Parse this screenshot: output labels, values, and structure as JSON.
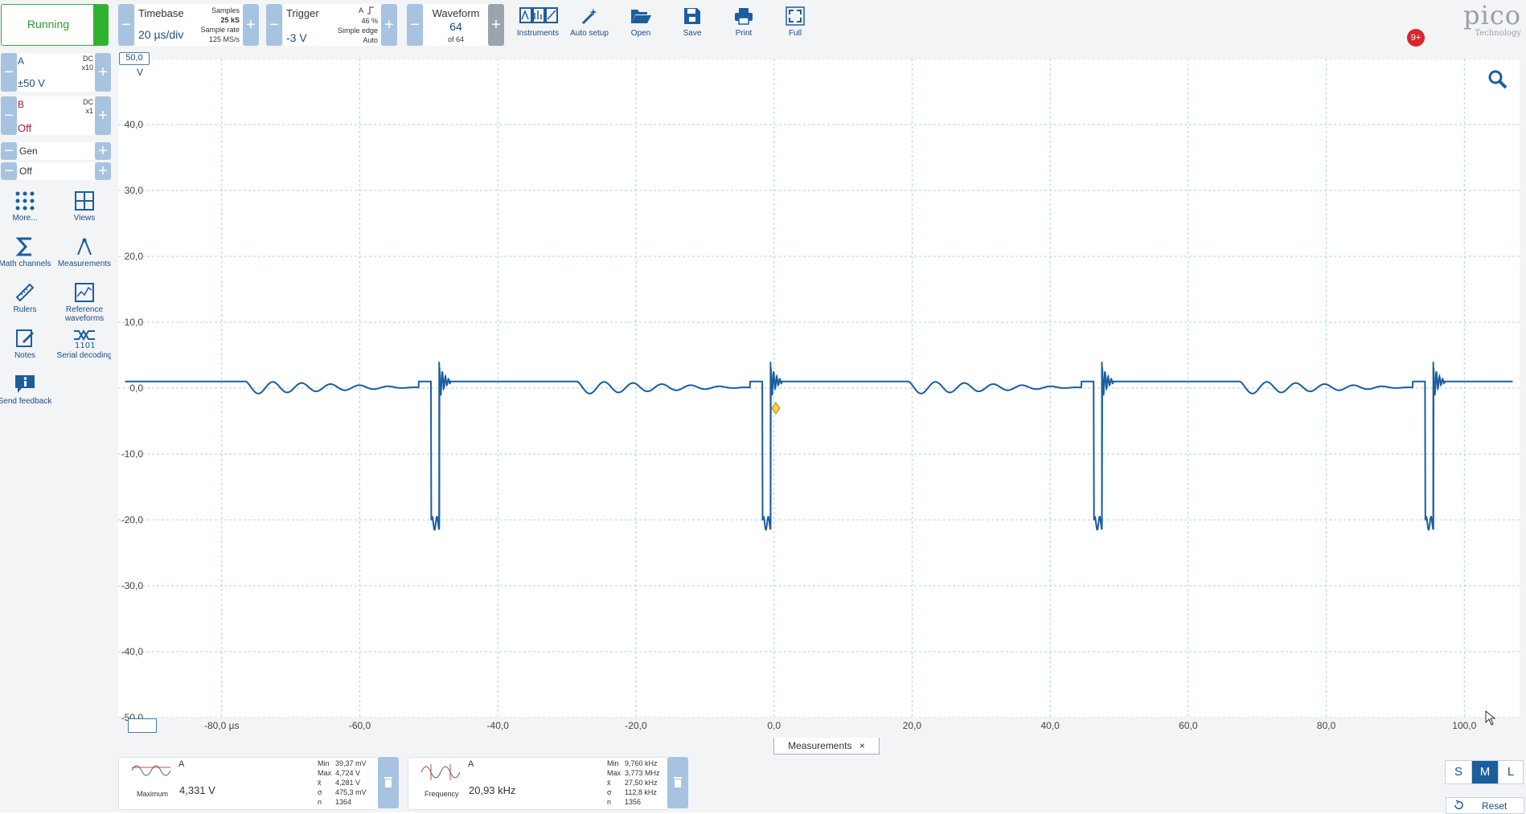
{
  "status": {
    "run_label": "Running"
  },
  "timebase": {
    "label": "Timebase",
    "value": "20 µs/div",
    "samples_label": "Samples",
    "samples_value": "25 kS",
    "rate_label": "Sample rate",
    "rate_value": "125 MS/s"
  },
  "trigger": {
    "label": "Trigger",
    "value": "-3 V",
    "channel": "A",
    "percent": "46 %",
    "type": "Simple edge",
    "mode": "Auto"
  },
  "waveform": {
    "label": "Waveform",
    "current": "64",
    "of": "of 64"
  },
  "toolbar": {
    "instruments": "Instruments",
    "auto_setup": "Auto setup",
    "open": "Open",
    "save": "Save",
    "print": "Print",
    "full": "Full"
  },
  "brand": {
    "logo": "pico",
    "logo_sub": "Technology",
    "notification_count": "9+"
  },
  "channels": [
    {
      "name": "A",
      "coupling": "DC",
      "probe": "x10",
      "range": "±50 V"
    },
    {
      "name": "B",
      "coupling": "DC",
      "probe": "x1",
      "range": "Off"
    }
  ],
  "generator": {
    "label": "Gen",
    "value": "Off"
  },
  "side_tools": {
    "more": "More...",
    "views": "Views",
    "math": "Math channels",
    "measurements": "Measurements",
    "rulers": "Rulers",
    "reference": "Reference waveforms",
    "notes": "Notes",
    "serial": "Serial decoding",
    "feedback": "Send feedback"
  },
  "plot": {
    "y_unit": "V",
    "y_ticks": [
      "50,0",
      "40,0",
      "30,0",
      "20,0",
      "10,0",
      "0,0",
      "-10,0",
      "-20,0",
      "-30,0",
      "-40,0",
      "-50,0"
    ],
    "x_ticks": [
      "-80,0 µs",
      "-60,0",
      "-40,0",
      "-20,0",
      "0,0",
      "20,0",
      "40,0",
      "60,0",
      "80,0",
      "100,0"
    ],
    "trace_color": "#1b5e9e",
    "grid_color": "#a9d4e0"
  },
  "chart_data": {
    "type": "line",
    "xlabel": "µs",
    "ylabel": "V",
    "xlim": [
      -95,
      108
    ],
    "ylim": [
      -50,
      50
    ],
    "series": [
      {
        "name": "A",
        "pulse_times_us": [
          -48.5,
          -0.5,
          47.5,
          95.5
        ],
        "baseline_v": 1.0,
        "pulse_min_v": -20.5,
        "pulse_max_v": 4.0,
        "ringing_amplitude_v": 1.0
      }
    ]
  },
  "measurements_tab": {
    "label": "Measurements"
  },
  "measurements": [
    {
      "channel": "A",
      "kind": "Maximum",
      "value": "4,331 V",
      "min": "39,37 mV",
      "max": "4,724 V",
      "mean": "4,281 V",
      "sigma": "475,3 mV",
      "n": "1364"
    },
    {
      "channel": "A",
      "kind": "Frequency",
      "value": "20,93 kHz",
      "min": "9,760 kHz",
      "max": "3,773 MHz",
      "mean": "27,50 kHz",
      "sigma": "112,8 kHz",
      "n": "1356"
    }
  ],
  "stat_labels": {
    "min": "Min",
    "max": "Max",
    "mean": "x̄",
    "sigma": "σ",
    "n": "n"
  },
  "view_sizes": {
    "s": "S",
    "m": "M",
    "l": "L"
  },
  "reset": {
    "label": "Reset"
  }
}
